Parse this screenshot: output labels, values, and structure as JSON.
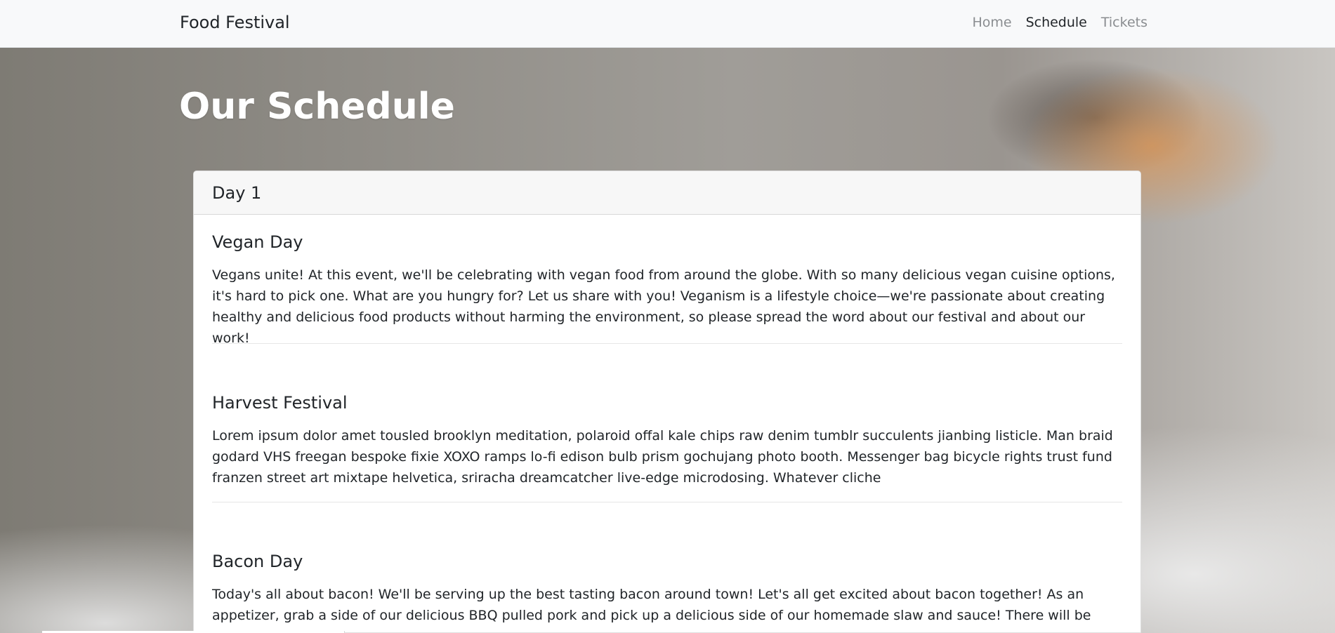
{
  "navbar": {
    "brand": "Food Festival",
    "links": [
      {
        "label": "Home",
        "active": false
      },
      {
        "label": "Schedule",
        "active": true
      },
      {
        "label": "Tickets",
        "active": false
      }
    ]
  },
  "hero": {
    "title": "Our Schedule"
  },
  "schedule": {
    "day_label": "Day 1",
    "events": [
      {
        "title": "Vegan Day",
        "description": "Vegans unite! At this event, we'll be celebrating with vegan food from around the globe. With so many delicious vegan cuisine options, it's hard to pick one. What are you hungry for? Let us share with you! Veganism is a lifestyle choice—we're passionate about creating healthy and delicious food products without harming the environment, so please spread the word about our festival and about our work!"
      },
      {
        "title": "Harvest Festival",
        "description": "Lorem ipsum dolor amet tousled brooklyn meditation, polaroid offal kale chips raw denim tumblr succulents jianbing listicle. Man braid godard VHS freegan bespoke fixie XOXO ramps lo-fi edison bulb prism gochujang photo booth. Messenger bag bicycle rights trust fund franzen street art mixtape helvetica, sriracha dreamcatcher live-edge microdosing. Whatever cliche"
      },
      {
        "title": "Bacon Day",
        "description": "Today's all about bacon! We'll be serving up the best tasting bacon around town! Let's all get excited about bacon together! As an appetizer, grab a side of our delicious BBQ pulled pork and pick up a delicious side of our homemade slaw and sauce! There will be bacon everywhere!!"
      }
    ]
  }
}
